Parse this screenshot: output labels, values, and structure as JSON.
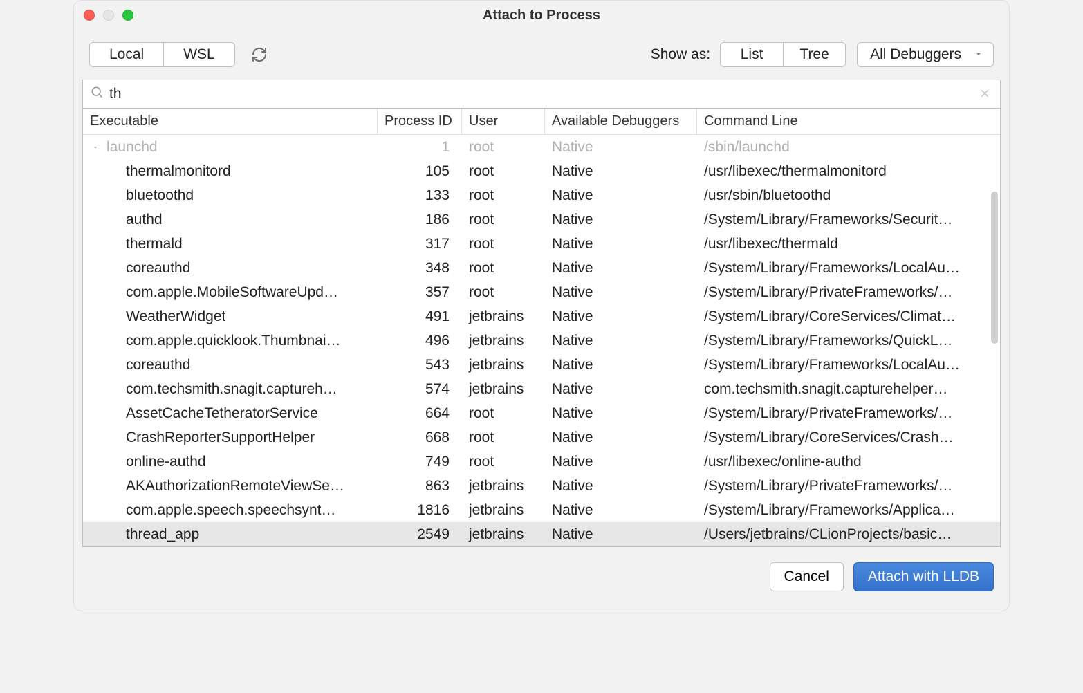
{
  "window": {
    "title": "Attach to Process"
  },
  "toolbar": {
    "source_tabs": [
      "Local",
      "WSL"
    ],
    "show_as_label": "Show as:",
    "view_tabs": [
      "List",
      "Tree"
    ],
    "debugger_filter": "All Debuggers"
  },
  "search": {
    "value": "th"
  },
  "columns": {
    "exe": "Executable",
    "pid": "Process ID",
    "user": "User",
    "avail": "Available Debuggers",
    "cmd": "Command Line"
  },
  "processes": [
    {
      "exe": "launchd",
      "pid": "1",
      "user": "root",
      "avail": "Native",
      "cmd": "/sbin/launchd",
      "parent": true,
      "disabled": true
    },
    {
      "exe": "thermalmonitord",
      "pid": "105",
      "user": "root",
      "avail": "Native",
      "cmd": "/usr/libexec/thermalmonitord"
    },
    {
      "exe": "bluetoothd",
      "pid": "133",
      "user": "root",
      "avail": "Native",
      "cmd": "/usr/sbin/bluetoothd"
    },
    {
      "exe": "authd",
      "pid": "186",
      "user": "root",
      "avail": "Native",
      "cmd": "/System/Library/Frameworks/Securit…"
    },
    {
      "exe": "thermald",
      "pid": "317",
      "user": "root",
      "avail": "Native",
      "cmd": "/usr/libexec/thermald"
    },
    {
      "exe": "coreauthd",
      "pid": "348",
      "user": "root",
      "avail": "Native",
      "cmd": "/System/Library/Frameworks/LocalAu…"
    },
    {
      "exe": "com.apple.MobileSoftwareUpd…",
      "pid": "357",
      "user": "root",
      "avail": "Native",
      "cmd": "/System/Library/PrivateFrameworks/…"
    },
    {
      "exe": "WeatherWidget",
      "pid": "491",
      "user": "jetbrains",
      "avail": "Native",
      "cmd": "/System/Library/CoreServices/Climat…"
    },
    {
      "exe": "com.apple.quicklook.Thumbnai…",
      "pid": "496",
      "user": "jetbrains",
      "avail": "Native",
      "cmd": "/System/Library/Frameworks/QuickL…"
    },
    {
      "exe": "coreauthd",
      "pid": "543",
      "user": "jetbrains",
      "avail": "Native",
      "cmd": "/System/Library/Frameworks/LocalAu…"
    },
    {
      "exe": "com.techsmith.snagit.captureh…",
      "pid": "574",
      "user": "jetbrains",
      "avail": "Native",
      "cmd": "com.techsmith.snagit.capturehelper…"
    },
    {
      "exe": "AssetCacheTetheratorService",
      "pid": "664",
      "user": "root",
      "avail": "Native",
      "cmd": "/System/Library/PrivateFrameworks/…"
    },
    {
      "exe": "CrashReporterSupportHelper",
      "pid": "668",
      "user": "root",
      "avail": "Native",
      "cmd": "/System/Library/CoreServices/Crash…"
    },
    {
      "exe": "online-authd",
      "pid": "749",
      "user": "root",
      "avail": "Native",
      "cmd": "/usr/libexec/online-authd"
    },
    {
      "exe": "AKAuthorizationRemoteViewSe…",
      "pid": "863",
      "user": "jetbrains",
      "avail": "Native",
      "cmd": "/System/Library/PrivateFrameworks/…"
    },
    {
      "exe": "com.apple.speech.speechsynt…",
      "pid": "1816",
      "user": "jetbrains",
      "avail": "Native",
      "cmd": "/System/Library/Frameworks/Applica…"
    },
    {
      "exe": "thread_app",
      "pid": "2549",
      "user": "jetbrains",
      "avail": "Native",
      "cmd": "/Users/jetbrains/CLionProjects/basic…",
      "selected": true
    }
  ],
  "buttons": {
    "cancel": "Cancel",
    "attach": "Attach with LLDB"
  }
}
